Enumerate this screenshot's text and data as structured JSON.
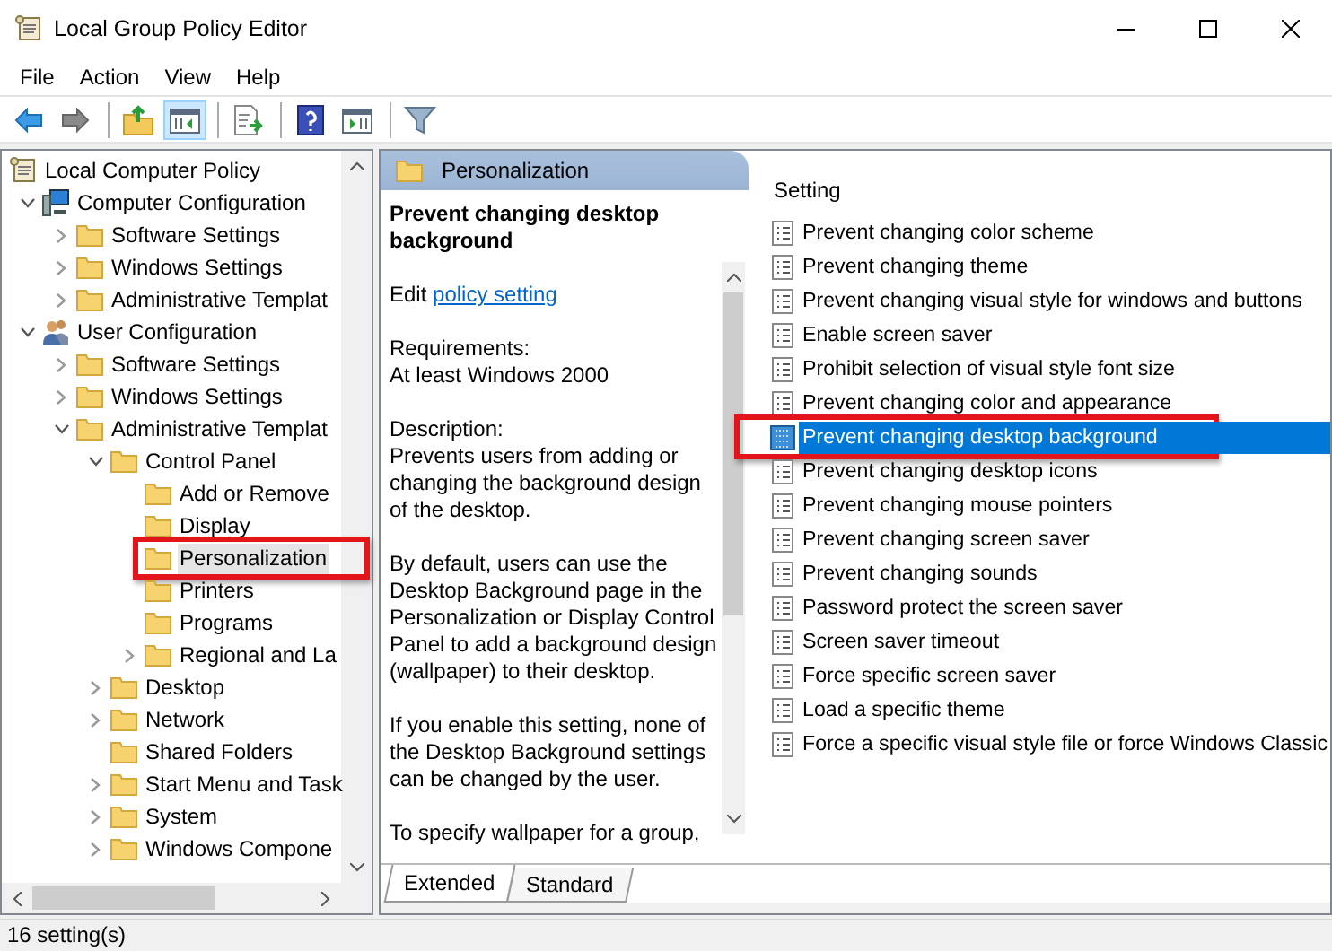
{
  "window": {
    "title": "Local Group Policy Editor"
  },
  "menu": [
    {
      "label": "File"
    },
    {
      "label": "Action"
    },
    {
      "label": "View"
    },
    {
      "label": "Help"
    }
  ],
  "toolbar": [
    {
      "kind": "back",
      "pressed": false
    },
    {
      "kind": "forward",
      "pressed": false
    },
    {
      "kind": "separator"
    },
    {
      "kind": "up",
      "pressed": false
    },
    {
      "kind": "tree-toggle",
      "pressed": true
    },
    {
      "kind": "separator"
    },
    {
      "kind": "export",
      "pressed": false
    },
    {
      "kind": "separator"
    },
    {
      "kind": "help",
      "pressed": false
    },
    {
      "kind": "action-pane",
      "pressed": false
    },
    {
      "kind": "separator"
    },
    {
      "kind": "filter",
      "pressed": false
    }
  ],
  "tree": [
    {
      "label": "Local Computer Policy",
      "kind": "policy",
      "selected": false,
      "highlighted": false,
      "children": [
        {
          "label": "Computer Configuration",
          "kind": "computer",
          "expanded": true,
          "selected": false,
          "highlighted": false,
          "children": [
            {
              "label": "Software Settings",
              "kind": "folder",
              "expanded": false,
              "selected": false,
              "highlighted": false
            },
            {
              "label": "Windows Settings",
              "kind": "folder",
              "expanded": false,
              "selected": false,
              "highlighted": false
            },
            {
              "label": "Administrative Templat",
              "kind": "folder",
              "expanded": false,
              "selected": false,
              "highlighted": false
            }
          ]
        },
        {
          "label": "User Configuration",
          "kind": "user",
          "expanded": true,
          "selected": false,
          "highlighted": false,
          "children": [
            {
              "label": "Software Settings",
              "kind": "folder",
              "expanded": false,
              "selected": false,
              "highlighted": false
            },
            {
              "label": "Windows Settings",
              "kind": "folder",
              "expanded": false,
              "selected": false,
              "highlighted": false
            },
            {
              "label": "Administrative Templat",
              "kind": "folder",
              "expanded": true,
              "selected": false,
              "highlighted": false,
              "children": [
                {
                  "label": "Control Panel",
                  "kind": "folder",
                  "expanded": true,
                  "selected": false,
                  "highlighted": false,
                  "children": [
                    {
                      "label": "Add or Remove",
                      "kind": "folder",
                      "selected": false,
                      "highlighted": false
                    },
                    {
                      "label": "Display",
                      "kind": "folder",
                      "selected": false,
                      "highlighted": false
                    },
                    {
                      "label": "Personalization",
                      "kind": "folder",
                      "selected": true,
                      "highlighted": true
                    },
                    {
                      "label": "Printers",
                      "kind": "folder",
                      "selected": false,
                      "highlighted": false
                    },
                    {
                      "label": "Programs",
                      "kind": "folder",
                      "selected": false,
                      "highlighted": false
                    },
                    {
                      "label": "Regional and La",
                      "kind": "folder",
                      "expanded": false,
                      "selected": false,
                      "highlighted": false
                    }
                  ]
                },
                {
                  "label": "Desktop",
                  "kind": "folder",
                  "expanded": false,
                  "selected": false,
                  "highlighted": false
                },
                {
                  "label": "Network",
                  "kind": "folder",
                  "expanded": false,
                  "selected": false,
                  "highlighted": false
                },
                {
                  "label": "Shared Folders",
                  "kind": "folder",
                  "selected": false,
                  "highlighted": false
                },
                {
                  "label": "Start Menu and Task",
                  "kind": "folder",
                  "expanded": false,
                  "selected": false,
                  "highlighted": false
                },
                {
                  "label": "System",
                  "kind": "folder",
                  "expanded": false,
                  "selected": false,
                  "highlighted": false
                },
                {
                  "label": "Windows Compone",
                  "kind": "folder",
                  "expanded": false,
                  "selected": false,
                  "highlighted": false
                }
              ]
            }
          ]
        }
      ]
    }
  ],
  "details": {
    "header": "Personalization",
    "title": "Prevent changing desktop background",
    "edit_prefix": "Edit",
    "edit_link": "policy setting",
    "paragraphs": [
      [
        "Requirements:",
        "At least Windows 2000"
      ],
      [
        "Description:",
        "Prevents users from adding or changing the background design of the desktop."
      ],
      [
        "By default, users can use the Desktop Background page in the Personalization or Display Control Panel to add a background design (wallpaper) to their desktop."
      ],
      [
        "If you enable this setting, none of the Desktop Background settings can be changed by the user."
      ],
      [
        "To specify wallpaper for a group,"
      ]
    ]
  },
  "tabs": [
    {
      "label": "Extended",
      "selected": true
    },
    {
      "label": "Standard",
      "selected": false
    }
  ],
  "settings": {
    "column": "Setting",
    "items": [
      {
        "label": "Prevent changing color scheme",
        "selected": false,
        "highlighted": false
      },
      {
        "label": "Prevent changing theme",
        "selected": false,
        "highlighted": false
      },
      {
        "label": "Prevent changing visual style for windows and buttons",
        "selected": false,
        "highlighted": false
      },
      {
        "label": "Enable screen saver",
        "selected": false,
        "highlighted": false
      },
      {
        "label": "Prohibit selection of visual style font size",
        "selected": false,
        "highlighted": false
      },
      {
        "label": "Prevent changing color and appearance",
        "selected": false,
        "highlighted": false
      },
      {
        "label": "Prevent changing desktop background",
        "selected": true,
        "highlighted": true
      },
      {
        "label": "Prevent changing desktop icons",
        "selected": false,
        "highlighted": false
      },
      {
        "label": "Prevent changing mouse pointers",
        "selected": false,
        "highlighted": false
      },
      {
        "label": "Prevent changing screen saver",
        "selected": false,
        "highlighted": false
      },
      {
        "label": "Prevent changing sounds",
        "selected": false,
        "highlighted": false
      },
      {
        "label": "Password protect the screen saver",
        "selected": false,
        "highlighted": false
      },
      {
        "label": "Screen saver timeout",
        "selected": false,
        "highlighted": false
      },
      {
        "label": "Force specific screen saver",
        "selected": false,
        "highlighted": false
      },
      {
        "label": "Load a specific theme",
        "selected": false,
        "highlighted": false
      },
      {
        "label": "Force a specific visual style file or force Windows Classic",
        "selected": false,
        "highlighted": false
      }
    ]
  },
  "status_bar": "16 setting(s)"
}
